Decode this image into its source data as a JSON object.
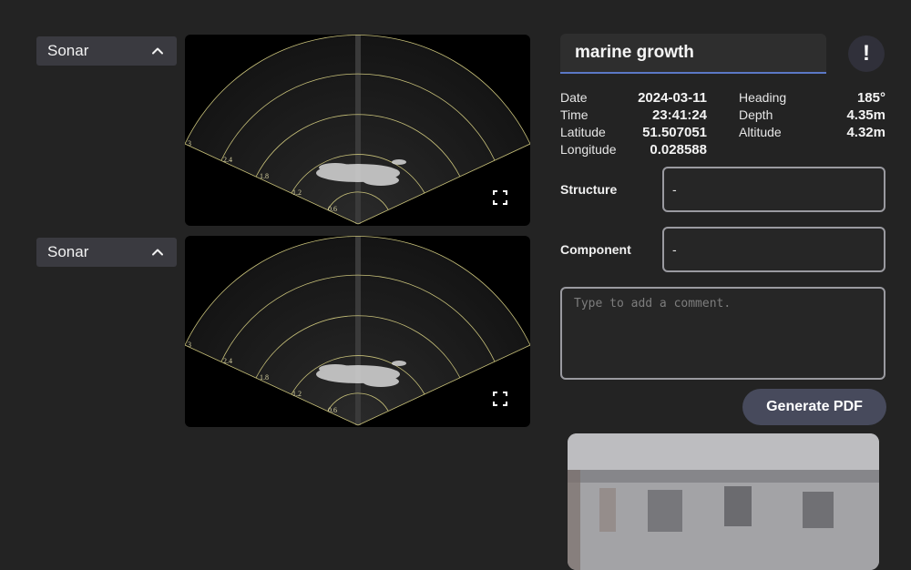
{
  "panels": [
    {
      "dropdown_label": "Sonar",
      "range_labels": [
        "3",
        "2.4",
        "1.8",
        "1.2",
        "0.6"
      ]
    },
    {
      "dropdown_label": "Sonar",
      "range_labels": [
        "3",
        "2.4",
        "1.8",
        "1.2",
        "0.6"
      ]
    }
  ],
  "inspection": {
    "title_value": "marine growth",
    "alert_symbol": "!",
    "meta_left": [
      {
        "label": "Date",
        "value": "2024-03-11"
      },
      {
        "label": "Time",
        "value": "23:41:24"
      },
      {
        "label": "Latitude",
        "value": "51.507051"
      },
      {
        "label": "Longitude",
        "value": "0.028588"
      }
    ],
    "meta_right": [
      {
        "label": "Heading",
        "value": "185°"
      },
      {
        "label": "Depth",
        "value": "4.35m"
      },
      {
        "label": "Altitude",
        "value": "4.32m"
      }
    ],
    "structure": {
      "label": "Structure",
      "value": "-"
    },
    "component": {
      "label": "Component",
      "value": "-"
    },
    "comment_placeholder": "Type to add a comment.",
    "generate_label": "Generate PDF"
  },
  "colors": {
    "accent_underline": "#5b78c6",
    "range_ring": "#c9c27a",
    "button_bg": "#474a5c"
  },
  "icons": [
    "chevron-up-icon",
    "fullscreen-icon",
    "exclamation-icon"
  ]
}
